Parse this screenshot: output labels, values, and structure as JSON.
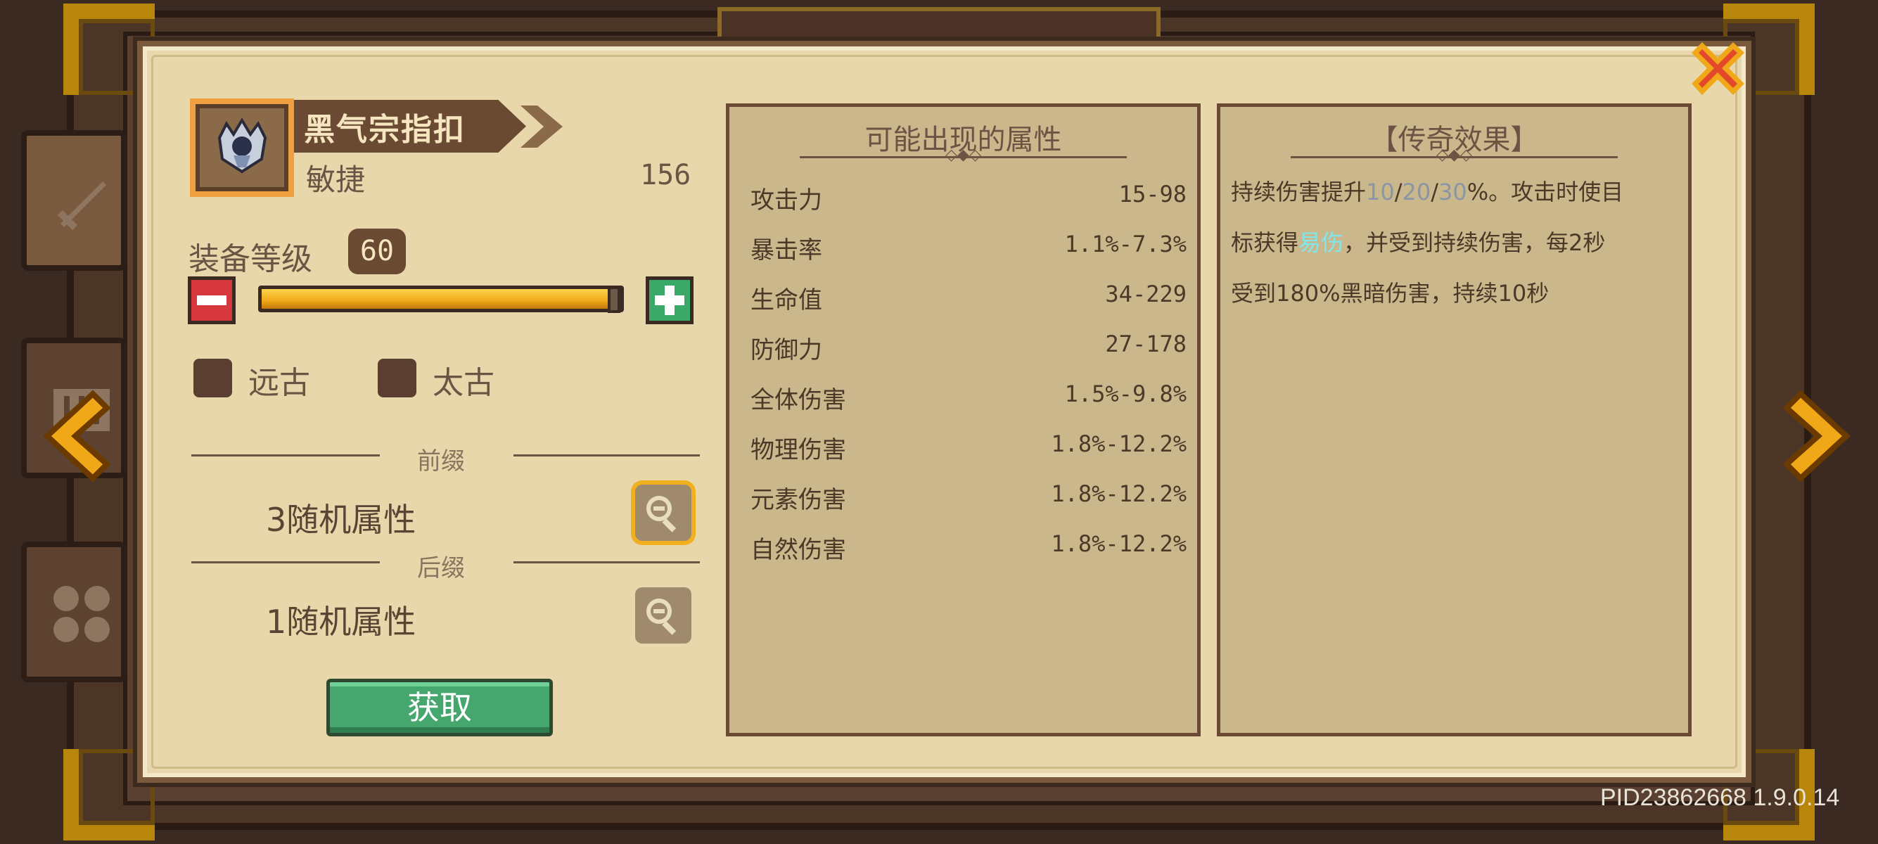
{
  "item": {
    "name": "黑气宗指扣",
    "type": "敏捷",
    "stat_value": "156",
    "icon": "gauntlet-icon"
  },
  "level": {
    "label": "装备等级",
    "value": "60",
    "fill_fraction": 1.0
  },
  "checkboxes": [
    {
      "label": "远古",
      "checked": false
    },
    {
      "label": "太古",
      "checked": false
    }
  ],
  "prefix": {
    "title": "前缀",
    "random_label": "3随机属性"
  },
  "suffix": {
    "title": "后缀",
    "random_label": "1随机属性"
  },
  "get_button": "获取",
  "attributes": {
    "title": "可能出现的属性",
    "rows": [
      {
        "name": "攻击力",
        "value": "15-98"
      },
      {
        "name": "暴击率",
        "value": "1.1%-7.3%"
      },
      {
        "name": "生命值",
        "value": "34-229"
      },
      {
        "name": "防御力",
        "value": "27-178"
      },
      {
        "name": "全体伤害",
        "value": "1.5%-9.8%"
      },
      {
        "name": "物理伤害",
        "value": "1.8%-12.2%"
      },
      {
        "name": "元素伤害",
        "value": "1.8%-12.2%"
      },
      {
        "name": "自然伤害",
        "value": "1.8%-12.2%"
      }
    ]
  },
  "legend": {
    "title": "【传奇效果】",
    "line1_a": "持续伤害提升",
    "line1_v1": "10",
    "line1_sep1": "/",
    "line1_v2": "20",
    "line1_sep2": "/",
    "line1_v3": "30",
    "line1_b": "%。攻击时使目",
    "line2_a": "标获得",
    "line2_hl": "易伤",
    "line2_b": "，并受到持续伤害，每2秒",
    "line3": "受到180%黑暗伤害，持续10秒"
  },
  "version": "PID23862668 1.9.0.14",
  "colors": {
    "panel_bg": "#e7d7aa",
    "box_bg": "#cbb78c",
    "accent_gold": "#f0a818",
    "close_red": "#e3482b",
    "button_green": "#45a66e",
    "button_red": "#d6373c",
    "highlight_cyan": "#7fe8ef",
    "highlight_gray": "#8a96a6"
  },
  "icons": [
    "sword-icon",
    "shield-icon",
    "grid-icon",
    "chevron-left-icon",
    "chevron-right-icon",
    "close-icon",
    "minus-icon",
    "plus-icon",
    "zoom-icon"
  ]
}
